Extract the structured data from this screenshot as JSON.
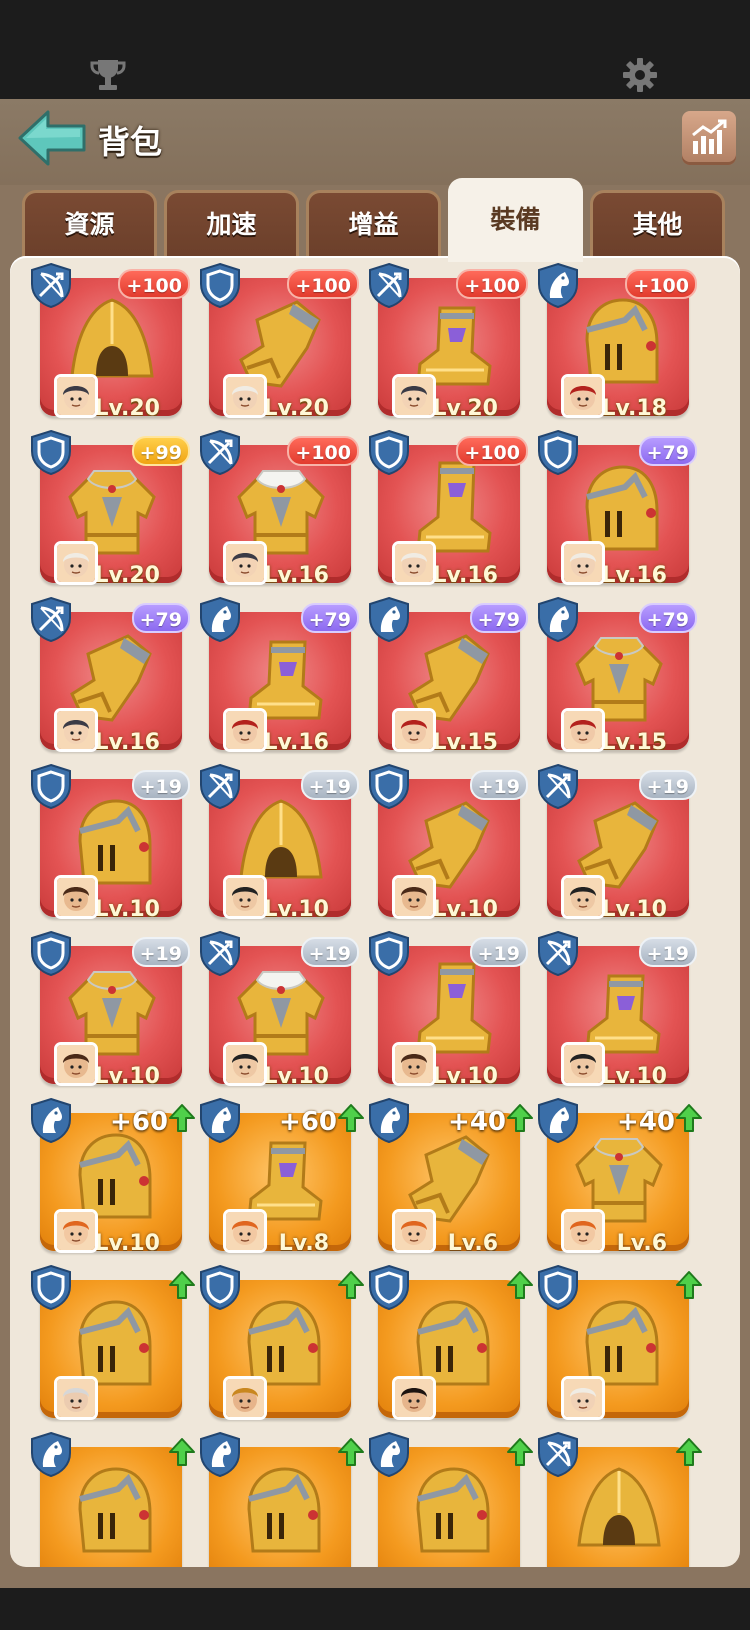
{
  "statusbar": {
    "left_icon": "trophy-icon",
    "right_icon": "gear-icon"
  },
  "header": {
    "title": "背包",
    "back_icon": "back-arrow-icon",
    "stats_icon": "chart-trend-icon"
  },
  "tabs": [
    {
      "label": "資源",
      "active": false
    },
    {
      "label": "加速",
      "active": false
    },
    {
      "label": "增益",
      "active": false
    },
    {
      "label": "裝備",
      "active": true
    },
    {
      "label": "其他",
      "active": false
    }
  ],
  "colors": {
    "accent_tab_text": "#5a3a22",
    "red_tile": "#e35353",
    "orange_tile": "#f49a1f"
  },
  "items": [
    {
      "type": "bow",
      "gear": "helmet-hood",
      "plus": "+100",
      "plus_style": "red",
      "tile": "red",
      "hero": "pilot",
      "level": "Lv.20"
    },
    {
      "type": "shield",
      "gear": "gauntlet",
      "plus": "+100",
      "plus_style": "red",
      "tile": "red",
      "hero": "elder",
      "level": "Lv.20"
    },
    {
      "type": "bow",
      "gear": "boot",
      "plus": "+100",
      "plus_style": "red",
      "tile": "red",
      "hero": "pilot",
      "level": "Lv.20"
    },
    {
      "type": "horse",
      "gear": "helmet-knight",
      "plus": "+100",
      "plus_style": "red",
      "tile": "red",
      "hero": "red-hair",
      "level": "Lv.18"
    },
    {
      "type": "shield",
      "gear": "armor",
      "plus": "+99",
      "plus_style": "gold",
      "tile": "red",
      "hero": "elder",
      "level": "Lv.20"
    },
    {
      "type": "bow",
      "gear": "armor-white",
      "plus": "+100",
      "plus_style": "red",
      "tile": "red",
      "hero": "pilot",
      "level": "Lv.16"
    },
    {
      "type": "shield",
      "gear": "boot-tall",
      "plus": "+100",
      "plus_style": "red",
      "tile": "red",
      "hero": "elder",
      "level": "Lv.16"
    },
    {
      "type": "shield",
      "gear": "helmet-knight",
      "plus": "+79",
      "plus_style": "purple",
      "tile": "red",
      "hero": "elder",
      "level": "Lv.16"
    },
    {
      "type": "bow",
      "gear": "gauntlet",
      "plus": "+79",
      "plus_style": "purple",
      "tile": "red",
      "hero": "pilot",
      "level": "Lv.16"
    },
    {
      "type": "horse",
      "gear": "boot",
      "plus": "+79",
      "plus_style": "purple",
      "tile": "red",
      "hero": "red-hair",
      "level": "Lv.16"
    },
    {
      "type": "horse",
      "gear": "gauntlet",
      "plus": "+79",
      "plus_style": "purple",
      "tile": "red",
      "hero": "red-hair",
      "level": "Lv.15"
    },
    {
      "type": "horse",
      "gear": "armor",
      "plus": "+79",
      "plus_style": "purple",
      "tile": "red",
      "hero": "red-hair",
      "level": "Lv.15"
    },
    {
      "type": "shield",
      "gear": "helmet-knight",
      "plus": "+19",
      "plus_style": "silver",
      "tile": "red",
      "hero": "boy",
      "level": "Lv.10"
    },
    {
      "type": "bow",
      "gear": "helmet-hood",
      "plus": "+19",
      "plus_style": "silver",
      "tile": "red",
      "hero": "pirate",
      "level": "Lv.10"
    },
    {
      "type": "shield",
      "gear": "gauntlet",
      "plus": "+19",
      "plus_style": "silver",
      "tile": "red",
      "hero": "boy",
      "level": "Lv.10"
    },
    {
      "type": "bow",
      "gear": "gauntlet",
      "plus": "+19",
      "plus_style": "silver",
      "tile": "red",
      "hero": "pirate",
      "level": "Lv.10"
    },
    {
      "type": "shield",
      "gear": "armor",
      "plus": "+19",
      "plus_style": "silver",
      "tile": "red",
      "hero": "boy",
      "level": "Lv.10"
    },
    {
      "type": "bow",
      "gear": "armor-white",
      "plus": "+19",
      "plus_style": "silver",
      "tile": "red",
      "hero": "pirate",
      "level": "Lv.10"
    },
    {
      "type": "shield",
      "gear": "boot-tall",
      "plus": "+19",
      "plus_style": "silver",
      "tile": "red",
      "hero": "boy",
      "level": "Lv.10"
    },
    {
      "type": "bow",
      "gear": "boot",
      "plus": "+19",
      "plus_style": "silver",
      "tile": "red",
      "hero": "pirate",
      "level": "Lv.10"
    },
    {
      "type": "horse",
      "gear": "helmet-knight",
      "plus": "+60",
      "plus_style": "plain",
      "tile": "orange",
      "hero": "ginger",
      "level": "Lv.10",
      "upgrade": true
    },
    {
      "type": "horse",
      "gear": "boot",
      "plus": "+60",
      "plus_style": "plain",
      "tile": "orange",
      "hero": "ginger",
      "level": "Lv.8",
      "upgrade": true
    },
    {
      "type": "horse",
      "gear": "gauntlet",
      "plus": "+40",
      "plus_style": "plain",
      "tile": "orange",
      "hero": "ginger",
      "level": "Lv.6",
      "upgrade": true
    },
    {
      "type": "horse",
      "gear": "armor",
      "plus": "+40",
      "plus_style": "plain",
      "tile": "orange",
      "hero": "ginger",
      "level": "Lv.6",
      "upgrade": true
    },
    {
      "type": "shield",
      "gear": "helmet-knight",
      "plus": "",
      "plus_style": "none",
      "tile": "orange",
      "hero": "grey",
      "level": "",
      "upgrade": true
    },
    {
      "type": "shield",
      "gear": "helmet-knight",
      "plus": "",
      "plus_style": "none",
      "tile": "orange",
      "hero": "spartan",
      "level": "",
      "upgrade": true
    },
    {
      "type": "shield",
      "gear": "helmet-knight",
      "plus": "",
      "plus_style": "none",
      "tile": "orange",
      "hero": "dark-hair",
      "level": "",
      "upgrade": true
    },
    {
      "type": "shield",
      "gear": "helmet-knight",
      "plus": "",
      "plus_style": "none",
      "tile": "orange",
      "hero": "elder",
      "level": "",
      "upgrade": true
    },
    {
      "type": "horse",
      "gear": "helmet-knight",
      "plus": "",
      "plus_style": "none",
      "tile": "orange",
      "hero": "",
      "level": "",
      "upgrade": true
    },
    {
      "type": "horse",
      "gear": "helmet-knight",
      "plus": "",
      "plus_style": "none",
      "tile": "orange",
      "hero": "",
      "level": "",
      "upgrade": true
    },
    {
      "type": "horse",
      "gear": "helmet-knight",
      "plus": "",
      "plus_style": "none",
      "tile": "orange",
      "hero": "",
      "level": "",
      "upgrade": true
    },
    {
      "type": "bow",
      "gear": "helmet-hood",
      "plus": "",
      "plus_style": "none",
      "tile": "orange",
      "hero": "",
      "level": "",
      "upgrade": true
    }
  ]
}
